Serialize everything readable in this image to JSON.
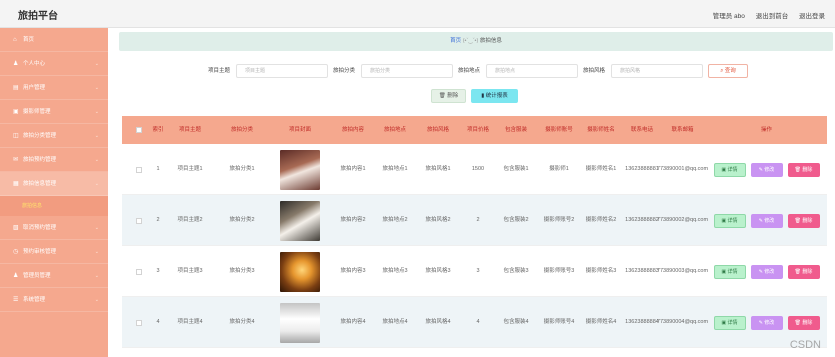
{
  "app": {
    "title": "旅拍平台",
    "user_label": "管理员 abo",
    "back_label": "退出到前台",
    "logout_label": "退出登录"
  },
  "sidebar": {
    "items": [
      {
        "icon": "home-icon",
        "glyph": "⌂",
        "label": "首页",
        "chevron": false
      },
      {
        "icon": "user-icon",
        "glyph": "♟",
        "label": "个人中心",
        "chevron": true
      },
      {
        "icon": "users-icon",
        "glyph": "▤",
        "label": "用户管理",
        "chevron": true
      },
      {
        "icon": "photographer-icon",
        "glyph": "▣",
        "label": "摄影师管理",
        "chevron": true
      },
      {
        "icon": "category-icon",
        "glyph": "◫",
        "label": "旅拍分类管理",
        "chevron": true
      },
      {
        "icon": "order-icon",
        "glyph": "✉",
        "label": "旅拍预约管理",
        "chevron": true
      },
      {
        "icon": "travel-icon",
        "glyph": "▦",
        "label": "旅拍信息管理",
        "chevron": true,
        "active": true
      },
      {
        "icon": "cancel-icon",
        "glyph": "▧",
        "label": "取消预约管理",
        "chevron": true
      },
      {
        "icon": "clock-icon",
        "glyph": "◷",
        "label": "预约审核管理",
        "chevron": true
      },
      {
        "icon": "admin-icon",
        "glyph": "♟",
        "label": "管理员管理",
        "chevron": true
      },
      {
        "icon": "system-icon",
        "glyph": "☰",
        "label": "系统管理",
        "chevron": true
      }
    ],
    "sub_item": "旅拍信息"
  },
  "breadcrumb": {
    "home": "首页",
    "face": "(•ˇ‿ˇ•)",
    "current": "旅拍信息"
  },
  "search": {
    "fields": [
      {
        "label": "项目主题",
        "placeholder": "项目主题"
      },
      {
        "label": "旅拍分类",
        "placeholder": "旅拍分类"
      },
      {
        "label": "旅拍地点",
        "placeholder": "旅拍地点"
      },
      {
        "label": "旅拍风格",
        "placeholder": "旅拍风格"
      }
    ],
    "button": "查询"
  },
  "actions": {
    "delete": "删除",
    "stats": "统计报表"
  },
  "table": {
    "headers": [
      "索引",
      "项目主题",
      "旅拍分类",
      "项目封面",
      "旅拍内容",
      "旅拍地点",
      "旅拍风格",
      "项目价格",
      "包含服装",
      "摄影师账号",
      "摄影师姓名",
      "联系电话",
      "联系邮箱",
      "操作"
    ],
    "rows": [
      {
        "index": "1",
        "theme": "项目主题1",
        "category": "旅拍分类1",
        "content": "旅拍内容1",
        "place": "旅拍地点1",
        "style": "旅拍风格1",
        "price": "1500",
        "clothes": "包含服装1",
        "account": "摄影师1",
        "name": "摄影师姓名1",
        "phone": "13623888881",
        "email": "773890001@qq.com"
      },
      {
        "index": "2",
        "theme": "项目主题2",
        "category": "旅拍分类2",
        "content": "旅拍内容2",
        "place": "旅拍地点2",
        "style": "旅拍风格2",
        "price": "2",
        "clothes": "包含服装2",
        "account": "摄影师账号2",
        "name": "摄影师姓名2",
        "phone": "13623888882",
        "email": "773890002@qq.com"
      },
      {
        "index": "3",
        "theme": "项目主题3",
        "category": "旅拍分类3",
        "content": "旅拍内容3",
        "place": "旅拍地点3",
        "style": "旅拍风格3",
        "price": "3",
        "clothes": "包含服装3",
        "account": "摄影师账号3",
        "name": "摄影师姓名3",
        "phone": "13623888883",
        "email": "773890003@qq.com"
      },
      {
        "index": "4",
        "theme": "项目主题4",
        "category": "旅拍分类4",
        "content": "旅拍内容4",
        "place": "旅拍地点4",
        "style": "旅拍风格4",
        "price": "4",
        "clothes": "包含服装4",
        "account": "摄影师账号4",
        "name": "摄影师姓名4",
        "phone": "13623888884",
        "email": "773890004@qq.com"
      }
    ],
    "op_detail": "详情",
    "op_edit": "修改",
    "op_delete": "删除"
  },
  "watermark": "CSDN"
}
